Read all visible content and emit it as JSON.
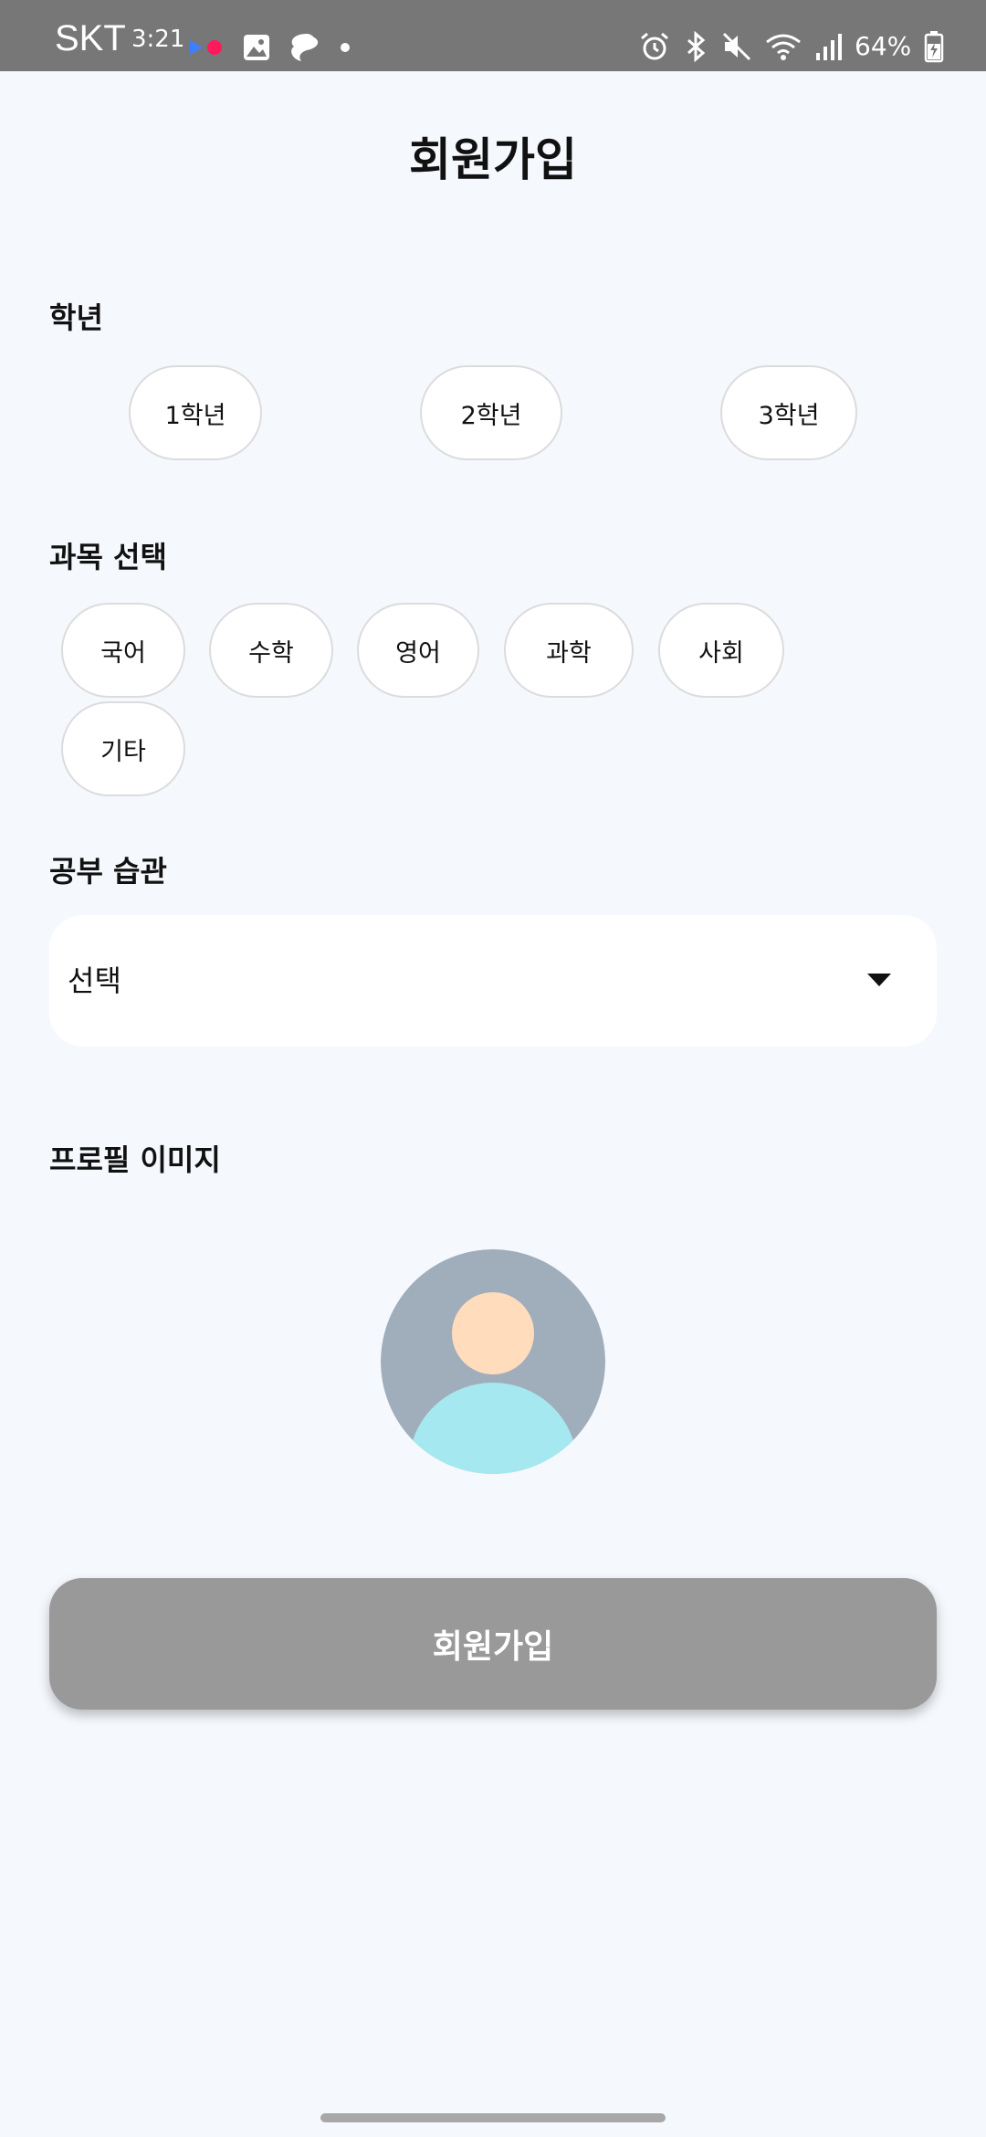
{
  "status_bar": {
    "carrier": "SKT",
    "time": "3:21",
    "battery": "64%",
    "left_icons": [
      "media-control-icon",
      "gallery-icon",
      "messenger-icon",
      "dot-icon"
    ],
    "right_icons": [
      "alarm-icon",
      "bluetooth-icon",
      "mute-icon",
      "wifi-icon",
      "signal-icon",
      "battery-icon"
    ]
  },
  "page": {
    "title": "회원가입"
  },
  "grade": {
    "label": "학년",
    "options": [
      "1학년",
      "2학년",
      "3학년"
    ]
  },
  "subjects": {
    "label": "과목 선택",
    "options": [
      "국어",
      "수학",
      "영어",
      "과학",
      "사회",
      "기타"
    ]
  },
  "study_habit": {
    "label": "공부 습관",
    "selected": "선택"
  },
  "profile_image": {
    "label": "프로필 이미지",
    "colors": {
      "background": "#a0adbb",
      "head": "#ffdcbc",
      "body": "#a5e8ef"
    }
  },
  "submit": {
    "label": "회원가입"
  },
  "colors": {
    "page_background": "#f5f8fd",
    "status_bar": "#777777",
    "button_disabled": "#999999",
    "chip_border": "#dcdcdc"
  }
}
